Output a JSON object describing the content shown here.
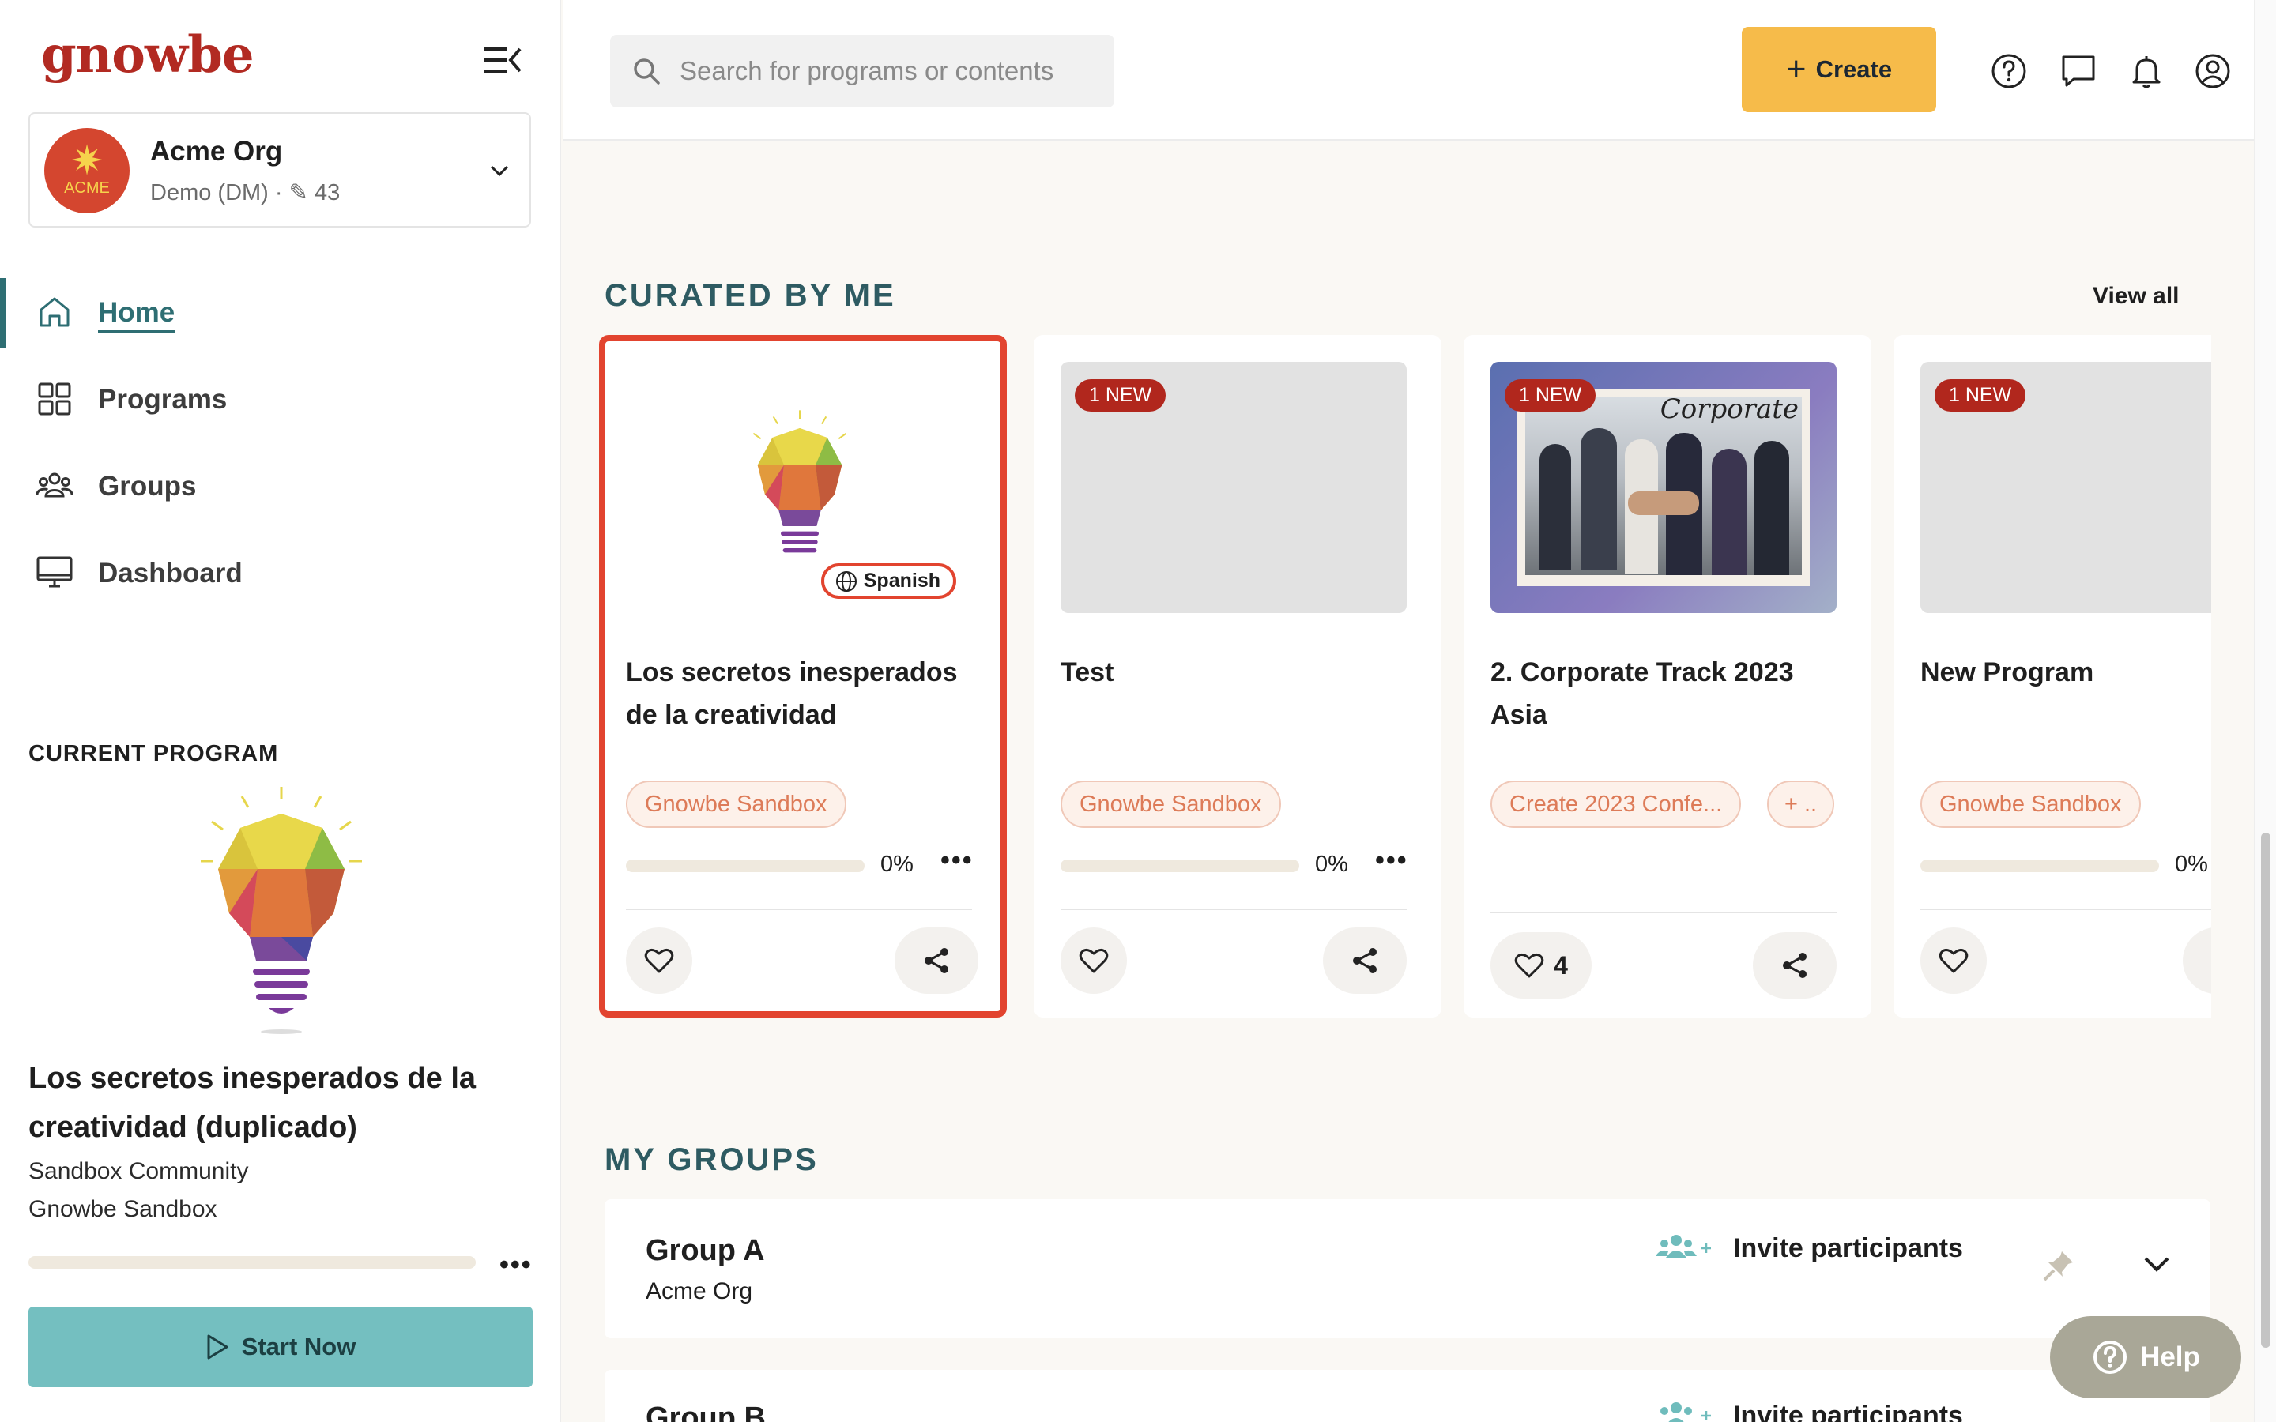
{
  "app": {
    "logo": "gnowbe"
  },
  "org": {
    "avatar_text": "ACME",
    "name": "Acme Org",
    "subtitle": "Demo (DM) · ✎ 43"
  },
  "sidebar": {
    "nav": [
      {
        "label": "Home",
        "icon": "home-icon",
        "active": true
      },
      {
        "label": "Programs",
        "icon": "grid-icon"
      },
      {
        "label": "Groups",
        "icon": "users-icon"
      },
      {
        "label": "Dashboard",
        "icon": "monitor-icon"
      }
    ],
    "current_program": {
      "heading": "CURRENT PROGRAM",
      "title": "Los secretos inesperados de la creatividad (duplicado)",
      "community": "Sandbox Community",
      "org": "Gnowbe Sandbox",
      "progress": 0,
      "start_label": "Start Now"
    }
  },
  "topbar": {
    "search_placeholder": "Search for programs or contents",
    "create_label": "Create"
  },
  "curated": {
    "heading": "CURATED BY ME",
    "view_all": "View all",
    "cards": [
      {
        "title": "Los secretos inesperados de la creatividad",
        "badge": "",
        "lang": "Spanish",
        "tags": [
          "Gnowbe Sandbox"
        ],
        "progress_text": "0%",
        "progress": 0,
        "likes": ""
      },
      {
        "title": "Test",
        "badge": "1 NEW",
        "lang": "",
        "tags": [
          "Gnowbe Sandbox"
        ],
        "progress_text": "0%",
        "progress": 0,
        "likes": ""
      },
      {
        "title": "2. Corporate Track 2023 Asia",
        "badge": "1 NEW",
        "lang": "",
        "tags": [
          "Create 2023 Confe...",
          "+ .."
        ],
        "progress_text": "",
        "progress": null,
        "likes": "4",
        "image_caption": "Corporate"
      },
      {
        "title": "New Program",
        "badge": "1 NEW",
        "lang": "",
        "tags": [
          "Gnowbe Sandbox"
        ],
        "progress_text": "0%",
        "progress": 0,
        "likes": ""
      }
    ]
  },
  "groups": {
    "heading": "MY GROUPS",
    "items": [
      {
        "name": "Group A",
        "org": "Acme Org",
        "invite_label": "Invite participants"
      },
      {
        "name": "Group B",
        "org": "",
        "invite_label": "Invite participants"
      }
    ]
  },
  "help": {
    "label": "Help"
  },
  "colors": {
    "brand": "#b22a22",
    "accent": "#2e6e73",
    "create": "#f6bb4a",
    "start": "#74bfc0",
    "highlight": "#e2442f"
  }
}
